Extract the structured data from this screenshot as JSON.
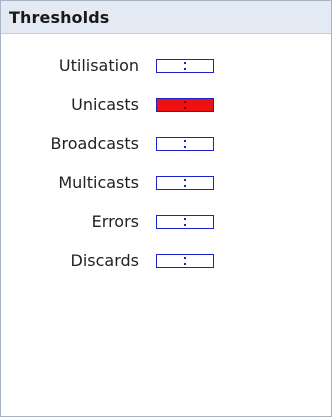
{
  "panel": {
    "title": "Thresholds"
  },
  "thresholds": [
    {
      "label": "Utilisation",
      "active": false
    },
    {
      "label": "Unicasts",
      "active": true
    },
    {
      "label": "Broadcasts",
      "active": false
    },
    {
      "label": "Multicasts",
      "active": false
    },
    {
      "label": "Errors",
      "active": false
    },
    {
      "label": "Discards",
      "active": false
    }
  ],
  "colors": {
    "swatch_border": "#1a22c8",
    "active_fill": "#ee1111",
    "inactive_fill": "#ffffff"
  }
}
